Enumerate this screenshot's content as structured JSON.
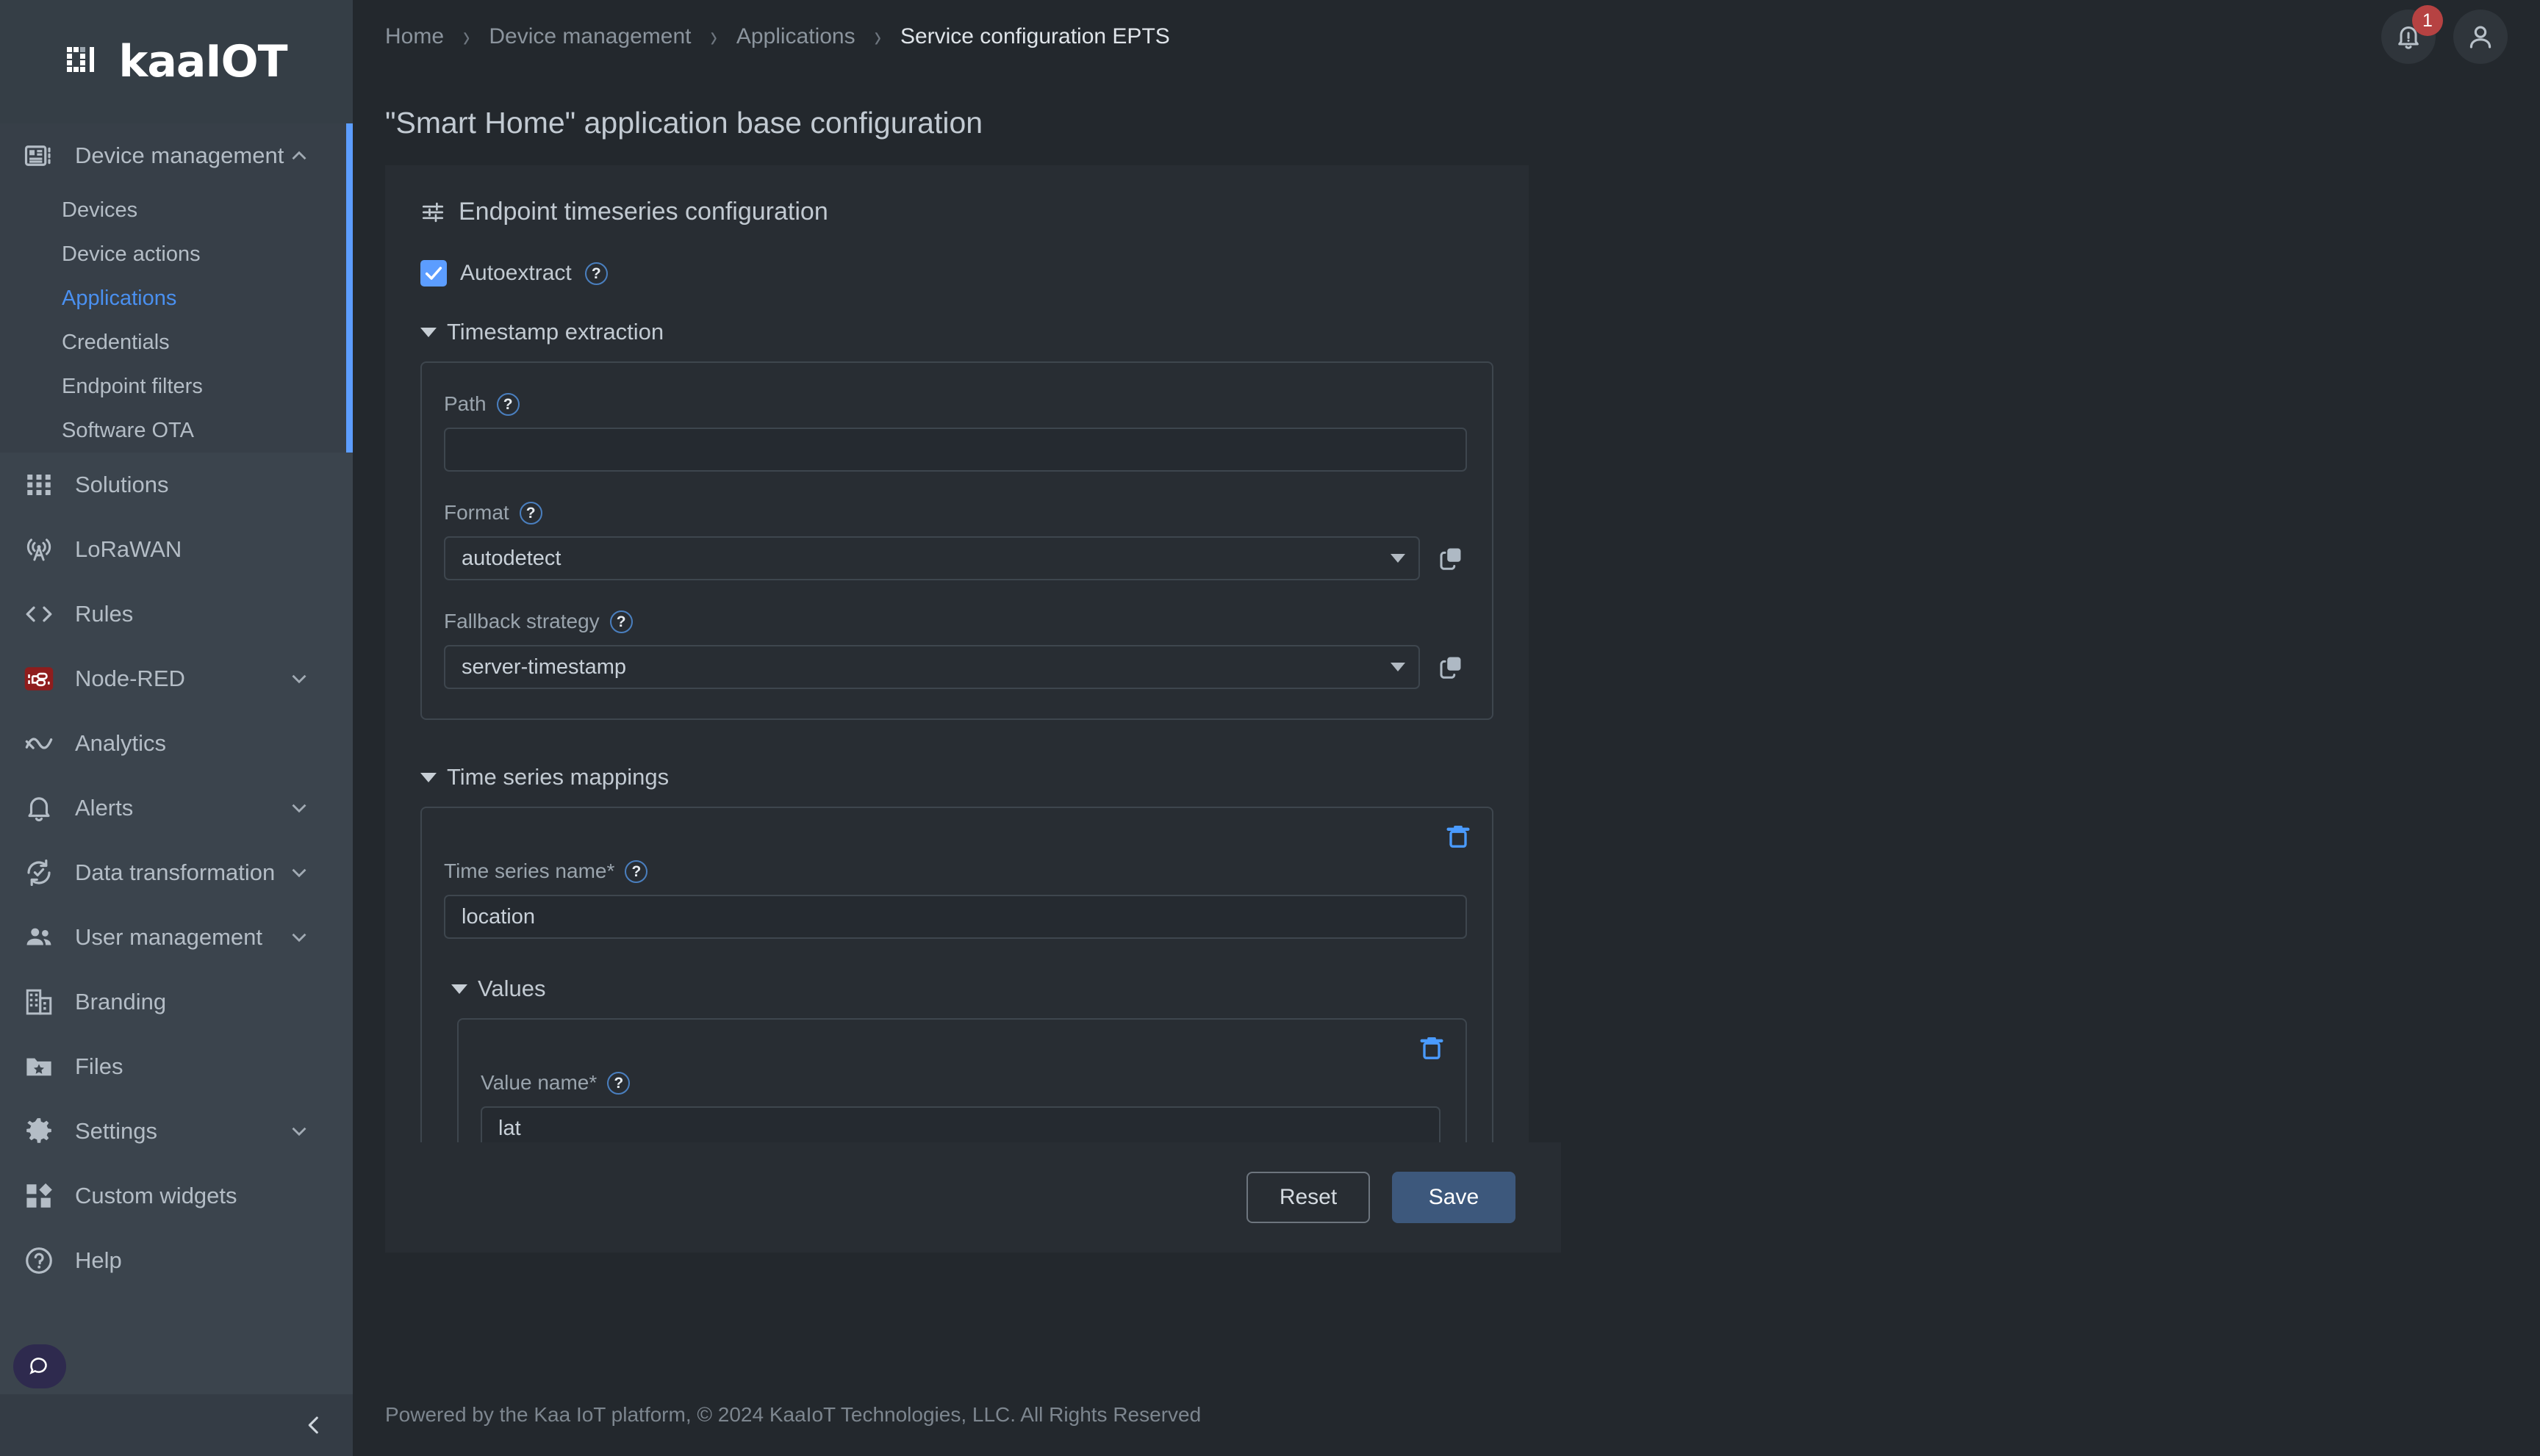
{
  "brand": {
    "name": "kaaIOT"
  },
  "sidebar": {
    "groups": [
      {
        "label": "Device management",
        "icon": "device-management-icon",
        "expanded": true,
        "active": true,
        "children": [
          {
            "label": "Devices",
            "selected": false
          },
          {
            "label": "Device actions",
            "selected": false
          },
          {
            "label": "Applications",
            "selected": true
          },
          {
            "label": "Credentials",
            "selected": false
          },
          {
            "label": "Endpoint filters",
            "selected": false
          },
          {
            "label": "Software OTA",
            "selected": false
          }
        ]
      },
      {
        "label": "Solutions",
        "icon": "grid-icon",
        "expandable": false
      },
      {
        "label": "LoRaWAN",
        "icon": "antenna-icon",
        "expandable": false
      },
      {
        "label": "Rules",
        "icon": "code-brackets-icon",
        "expandable": false
      },
      {
        "label": "Node-RED",
        "icon": "node-red-icon",
        "expandable": true
      },
      {
        "label": "Analytics",
        "icon": "analytics-icon",
        "expandable": false
      },
      {
        "label": "Alerts",
        "icon": "bell-icon",
        "expandable": true
      },
      {
        "label": "Data transformation",
        "icon": "transform-icon",
        "expandable": true
      },
      {
        "label": "User management",
        "icon": "users-icon",
        "expandable": true
      },
      {
        "label": "Branding",
        "icon": "building-icon",
        "expandable": false
      },
      {
        "label": "Files",
        "icon": "folder-star-icon",
        "expandable": false
      },
      {
        "label": "Settings",
        "icon": "gear-icon",
        "expandable": true
      },
      {
        "label": "Custom widgets",
        "icon": "widgets-icon",
        "expandable": false
      },
      {
        "label": "Help",
        "icon": "help-circle-icon",
        "expandable": false
      }
    ]
  },
  "topbar": {
    "breadcrumb": [
      "Home",
      "Device management",
      "Applications",
      "Service configuration EPTS"
    ],
    "separator": "›",
    "notifications_count": "1"
  },
  "page": {
    "title": "\"Smart Home\" application base configuration"
  },
  "section": {
    "title": "Endpoint timeseries configuration",
    "autoextract": {
      "label": "Autoextract",
      "checked": true,
      "help": "?"
    }
  },
  "timestamp_extraction": {
    "title": "Timestamp extraction",
    "path": {
      "label": "Path",
      "help": "?",
      "value": "",
      "placeholder": ""
    },
    "format": {
      "label": "Format",
      "help": "?",
      "value": "autodetect"
    },
    "fallback": {
      "label": "Fallback strategy",
      "help": "?",
      "value": "server-timestamp"
    }
  },
  "time_series_mappings": {
    "title": "Time series mappings",
    "mapping": {
      "name_label": "Time series name*",
      "name_help": "?",
      "name_value": "location",
      "values_title": "Values",
      "value": {
        "label": "Value name*",
        "help": "?",
        "value": "lat"
      }
    }
  },
  "actions": {
    "reset": "Reset",
    "save": "Save"
  },
  "footer": {
    "text": "Powered by the Kaa IoT platform, © 2024 KaaIoT Technologies, LLC. All Rights Reserved"
  },
  "colors": {
    "accent": "#5c9dff",
    "primary_button": "#3d587c",
    "badge": "#b64242",
    "sidebar": "#3b444d",
    "surface": "#282d33",
    "background": "#23282d"
  }
}
